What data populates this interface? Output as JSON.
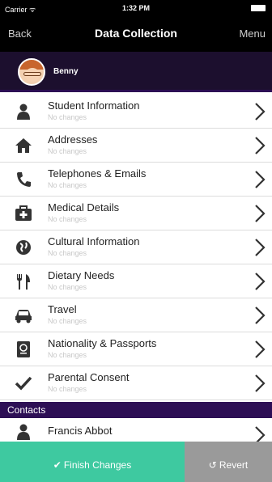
{
  "status_bar": {
    "carrier": "Carrier ᯤ",
    "time": "1:32 PM"
  },
  "nav": {
    "back": "Back",
    "title": "Data Collection",
    "menu": "Menu"
  },
  "user": {
    "name": "Benny"
  },
  "items": [
    {
      "label": "Student Information",
      "status": "No changes",
      "icon": "person-icon"
    },
    {
      "label": "Addresses",
      "status": "No changes",
      "icon": "home-icon"
    },
    {
      "label": "Telephones & Emails",
      "status": "No changes",
      "icon": "phone-icon"
    },
    {
      "label": "Medical Details",
      "status": "No changes",
      "icon": "medical-kit-icon"
    },
    {
      "label": "Cultural Information",
      "status": "No changes",
      "icon": "globe-icon"
    },
    {
      "label": "Dietary Needs",
      "status": "No changes",
      "icon": "fork-knife-icon"
    },
    {
      "label": "Travel",
      "status": "No changes",
      "icon": "car-icon"
    },
    {
      "label": "Nationality & Passports",
      "status": "No changes",
      "icon": "passport-icon"
    },
    {
      "label": "Parental Consent",
      "status": "No changes",
      "icon": "checkmark-icon"
    }
  ],
  "contacts": {
    "header": "Contacts",
    "items": [
      {
        "name": "Francis Abbot",
        "icon": "person-icon"
      }
    ]
  },
  "actions": {
    "finish": "Finish Changes",
    "revert": "Revert"
  },
  "colors": {
    "accent_purple": "#2d0f55",
    "finish_green": "#3ec9a0",
    "revert_gray": "#9a9a9a"
  }
}
